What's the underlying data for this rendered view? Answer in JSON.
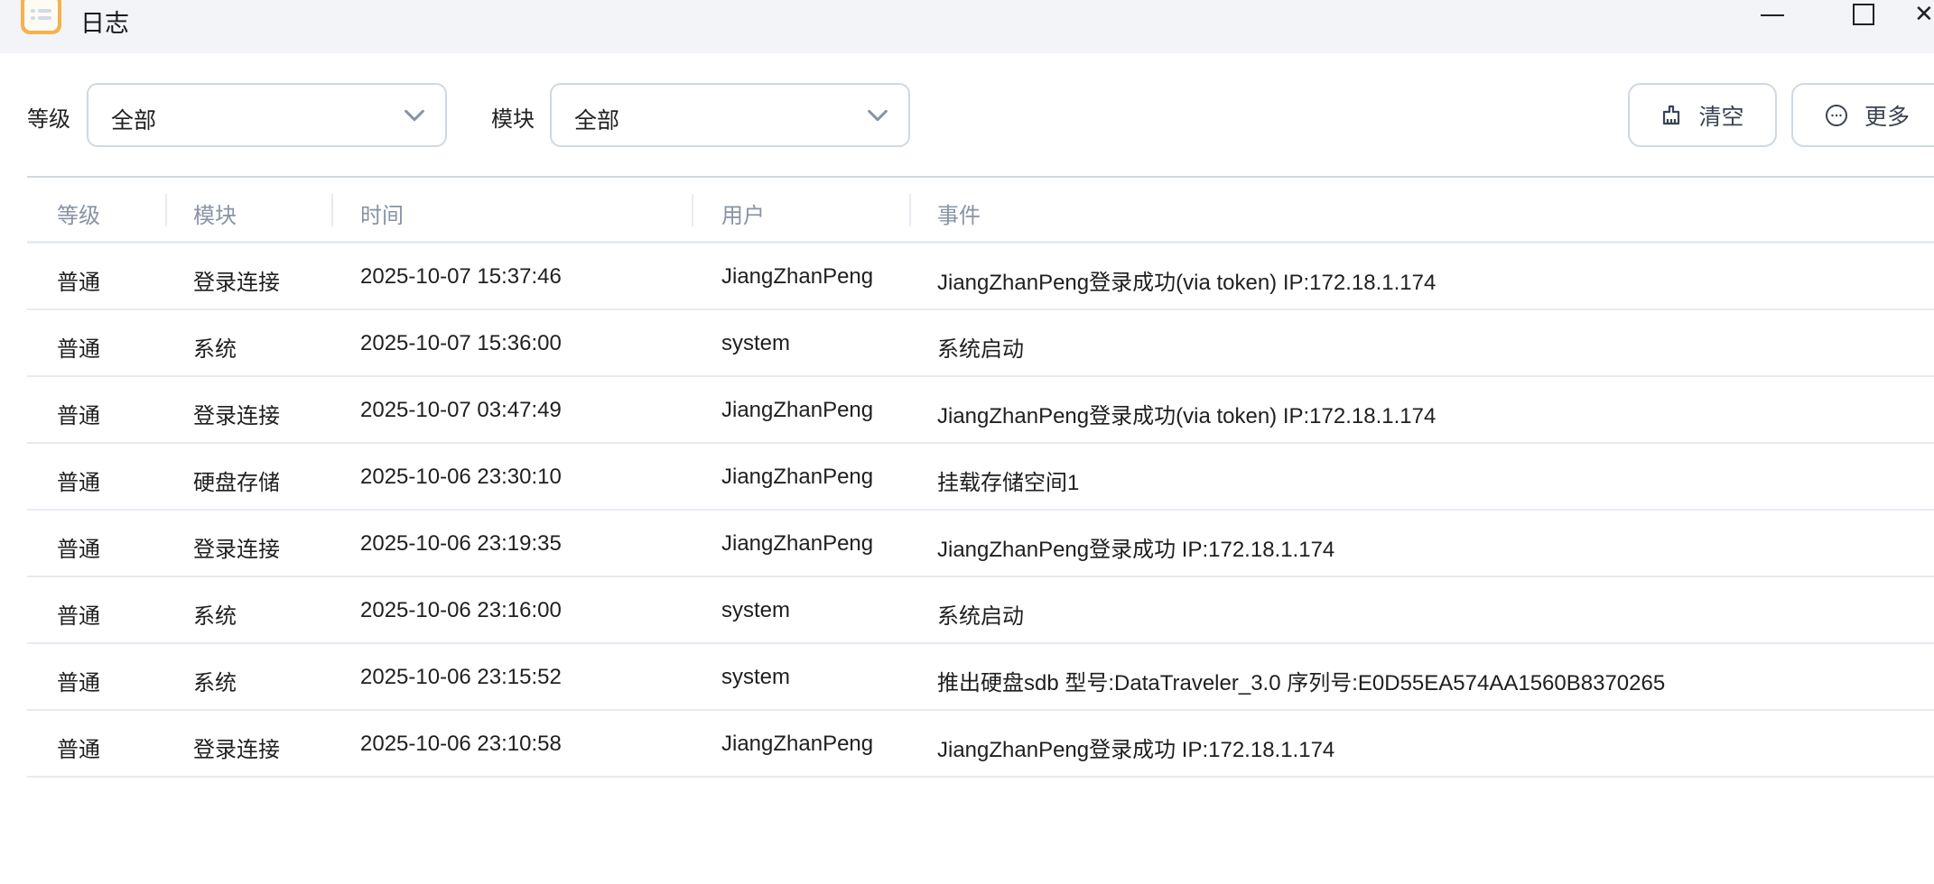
{
  "window": {
    "title": "日志",
    "icon": "log-list-icon"
  },
  "filters": {
    "level_label": "等级",
    "level_value": "全部",
    "module_label": "模块",
    "module_value": "全部"
  },
  "toolbar": {
    "clear_label": "清空",
    "clear_icon": "broom-icon",
    "more_label": "更多",
    "more_icon": "more-circle-icon"
  },
  "table": {
    "columns": [
      "等级",
      "模块",
      "时间",
      "用户",
      "事件"
    ],
    "rows": [
      [
        "普通",
        "登录连接",
        "2025-10-07 15:37:46",
        "JiangZhanPeng",
        "JiangZhanPeng登录成功(via token) IP:172.18.1.174"
      ],
      [
        "普通",
        "系统",
        "2025-10-07 15:36:00",
        "system",
        "系统启动"
      ],
      [
        "普通",
        "登录连接",
        "2025-10-07 03:47:49",
        "JiangZhanPeng",
        "JiangZhanPeng登录成功(via token) IP:172.18.1.174"
      ],
      [
        "普通",
        "硬盘存储",
        "2025-10-06 23:30:10",
        "JiangZhanPeng",
        "挂载存储空间1"
      ],
      [
        "普通",
        "登录连接",
        "2025-10-06 23:19:35",
        "JiangZhanPeng",
        "JiangZhanPeng登录成功 IP:172.18.1.174"
      ],
      [
        "普通",
        "系统",
        "2025-10-06 23:16:00",
        "system",
        "系统启动"
      ],
      [
        "普通",
        "系统",
        "2025-10-06 23:15:52",
        "system",
        "推出硬盘sdb 型号:DataTraveler_3.0 序列号:E0D55EA574AA1560B8370265"
      ],
      [
        "普通",
        "登录连接",
        "2025-10-06 23:10:58",
        "JiangZhanPeng",
        "JiangZhanPeng登录成功 IP:172.18.1.174"
      ]
    ]
  }
}
